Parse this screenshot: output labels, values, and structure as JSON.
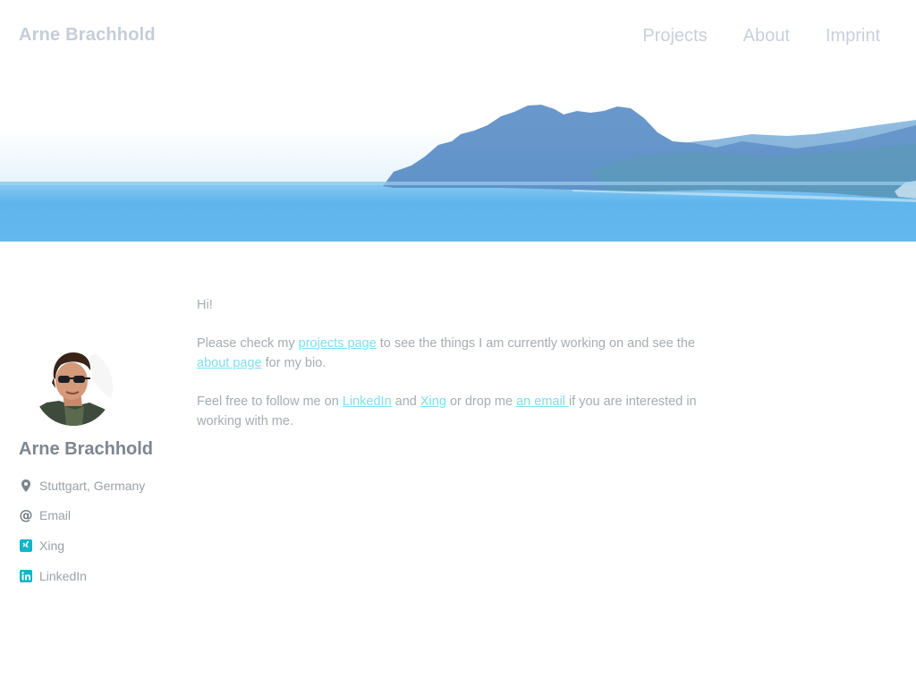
{
  "header": {
    "site_title": "Arne Brachhold",
    "nav": [
      {
        "label": "Projects"
      },
      {
        "label": "About"
      },
      {
        "label": "Imprint"
      }
    ]
  },
  "hero": {
    "image": "mountain-coast-sea-panorama",
    "colors": {
      "sky": "#ffffff",
      "sea": "#5cb5ec",
      "mountain": "#6f9ecf"
    }
  },
  "sidebar": {
    "avatar": "author-portrait",
    "name": "Arne Brachhold",
    "links": [
      {
        "icon": "location-pin-icon",
        "label": "Stuttgart, Germany"
      },
      {
        "icon": "at-sign-icon",
        "label": "Email"
      },
      {
        "icon": "xing-icon",
        "label": "Xing"
      },
      {
        "icon": "linkedin-icon",
        "label": "LinkedIn"
      }
    ]
  },
  "content": {
    "greeting": "Hi!",
    "p2": {
      "t1": "Please check my ",
      "link1": "projects page",
      "t2": " to see the things I am currently working on and see the ",
      "link2": "about page",
      "t3": " for my bio."
    },
    "p3": {
      "t1": "Feel free to follow me on ",
      "link1": "LinkedIn",
      "t2": " and ",
      "link2": "Xing",
      "t3": " or drop me ",
      "link3": "an email ",
      "t4": "if you are interested in working with me."
    },
    "link_color": "#7fdef0",
    "icon_color": "#11b5c9"
  }
}
